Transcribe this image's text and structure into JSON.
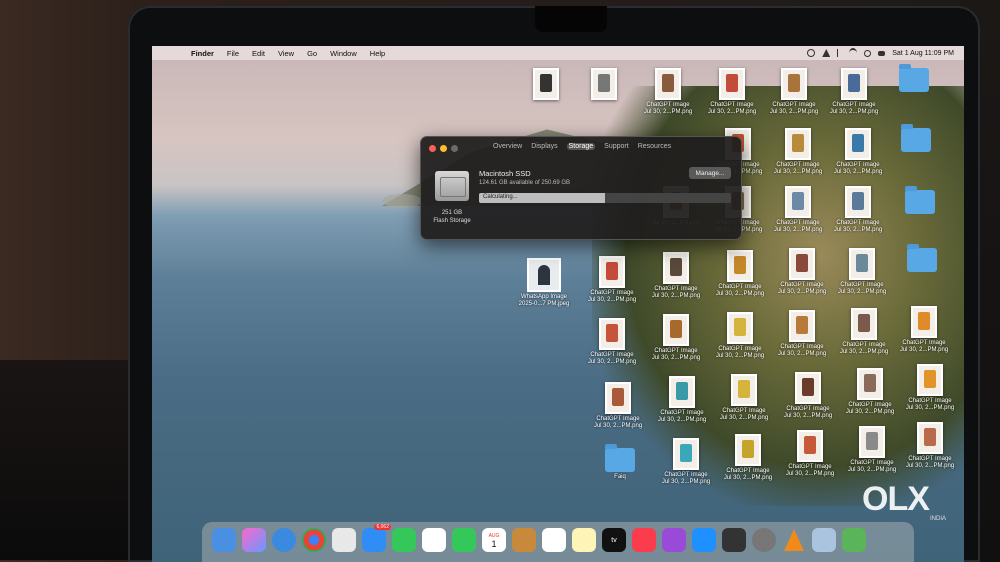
{
  "menubar": {
    "app": "Finder",
    "items": [
      "File",
      "Edit",
      "View",
      "Go",
      "Window",
      "Help"
    ],
    "clock": "Sat 1 Aug  11:09 PM"
  },
  "about_window": {
    "tabs": [
      "Overview",
      "Displays",
      "Storage",
      "Support",
      "Resources"
    ],
    "active_tab": "Storage",
    "disk_name": "Macintosh SSD",
    "available": "124.61 GB available of 250.69 GB",
    "manage_label": "Manage...",
    "status": "Calculating...",
    "used_fraction": 0.5,
    "capacity": "251 GB",
    "capacity_type": "Flash Storage"
  },
  "desktop": {
    "chatgpt_label": "ChatGPT Image",
    "chatgpt_sub": "Jul 30, 2...PM.png",
    "whatsapp_label": "WhatsApp Image",
    "whatsapp_sub": "2025-0...7 PM.jpeg",
    "folder_faiq": "Faiq"
  },
  "dock": {
    "mail_badge": "6,062",
    "calendar_month": "AUG",
    "calendar_day": "1",
    "tv_label": "tv"
  },
  "watermark": {
    "brand": "OLX",
    "sub": "INDIA"
  }
}
